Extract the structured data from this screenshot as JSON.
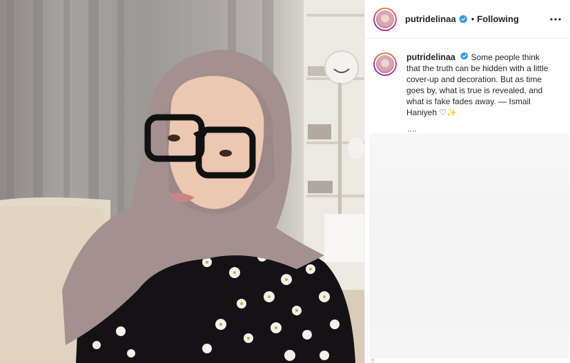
{
  "post": {
    "username": "putridelinaa",
    "follow_state": "Following",
    "separator": "•",
    "caption": "Some people think that the truth can be hidden with a little cover-up and decoration. But as time goes by, what is true is revealed, and what is fake fades away. — Ismail Haniyeh ♡✨"
  },
  "icons": {
    "verified": "verified-badge-icon",
    "more": "more-options-icon",
    "avatar": "profile-avatar"
  },
  "colors": {
    "verified_blue": "#3897f0",
    "text": "#262626",
    "divider": "#efefef"
  }
}
